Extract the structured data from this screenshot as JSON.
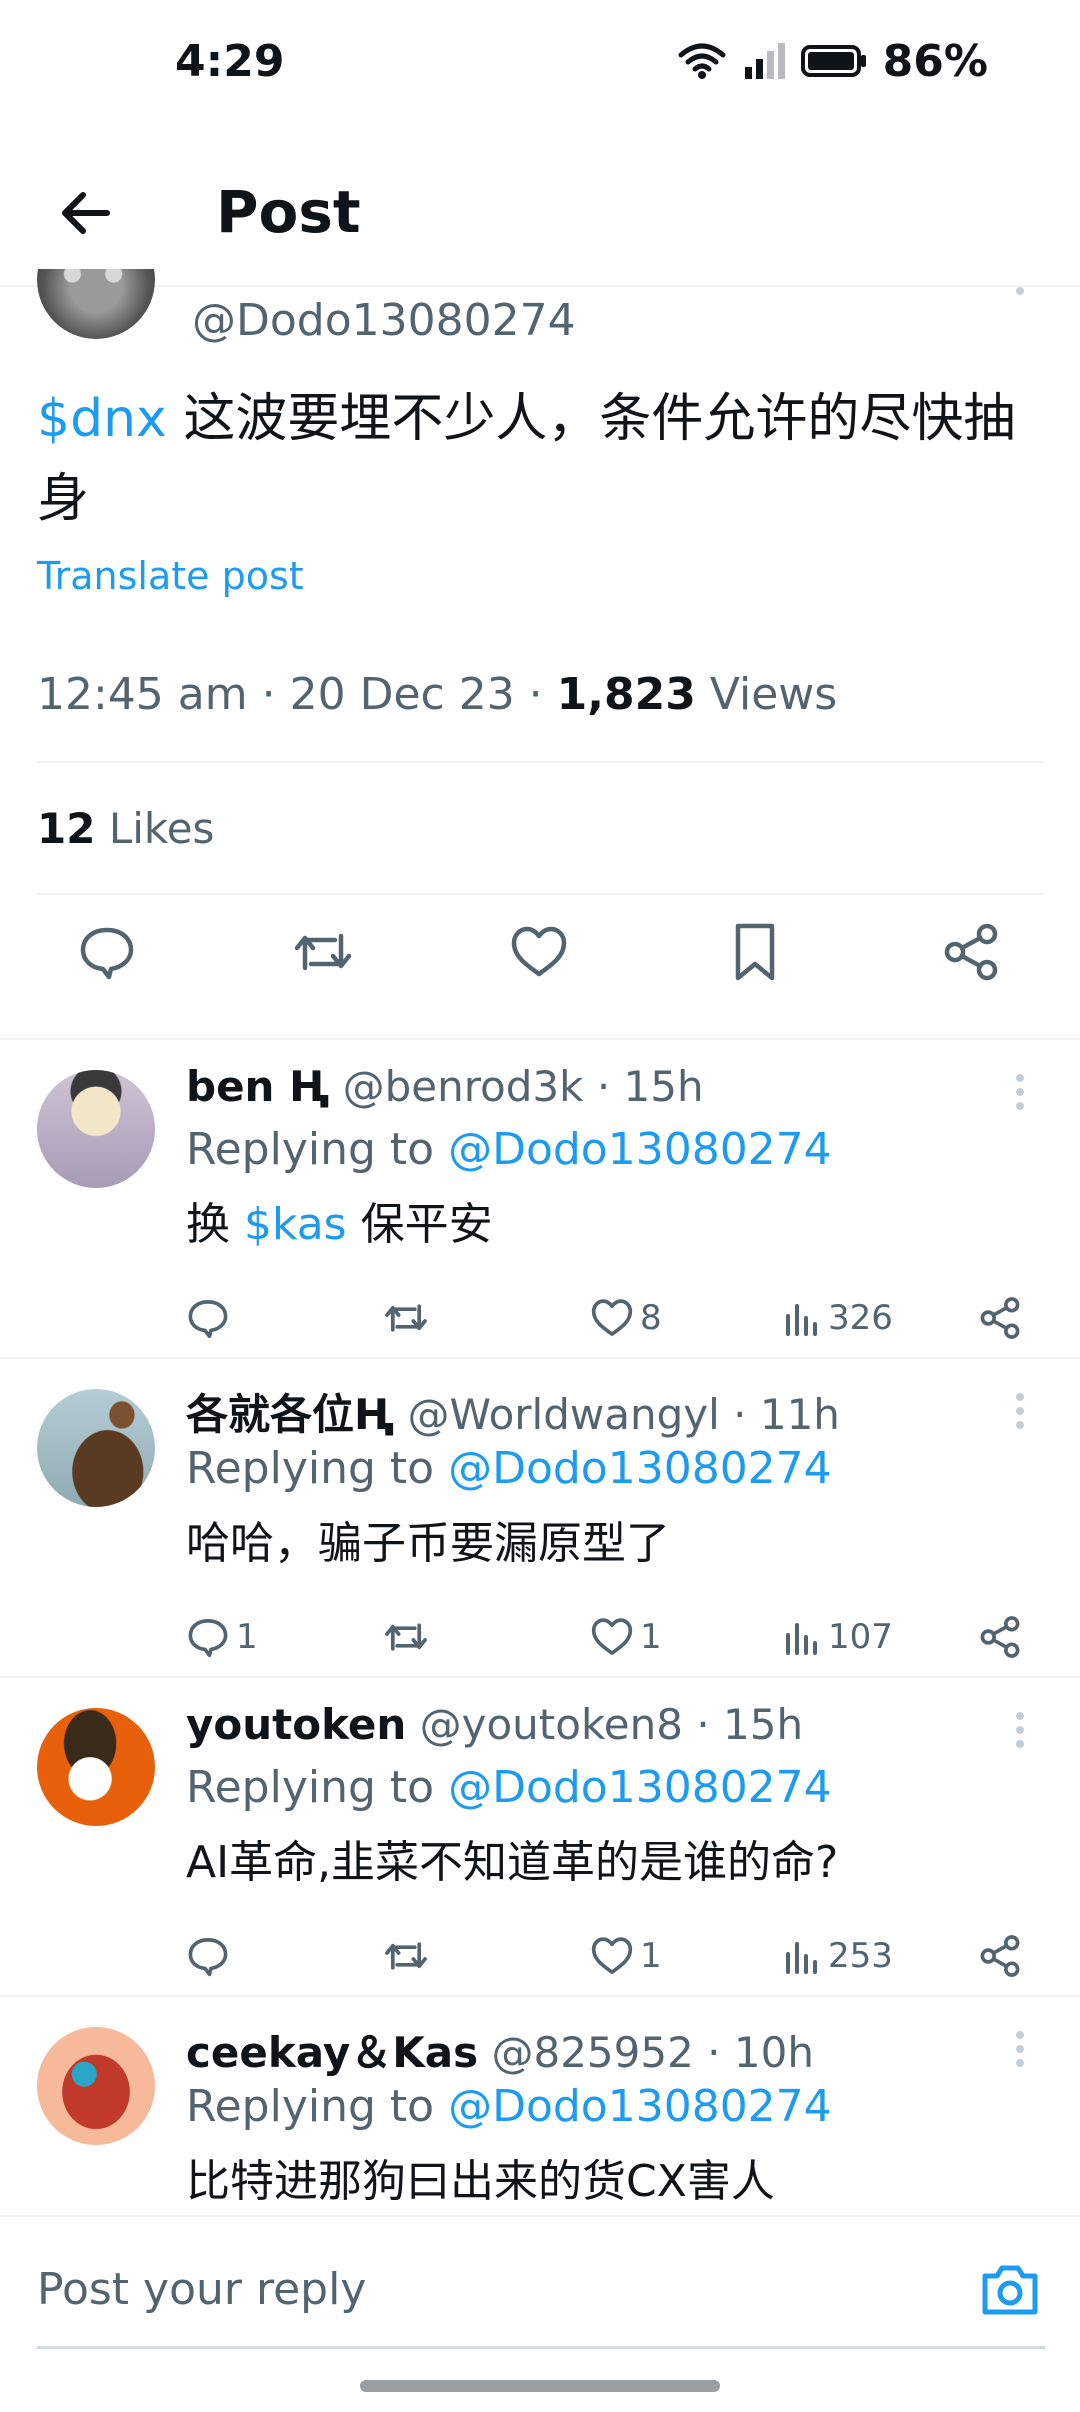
{
  "status_bar": {
    "time": "4:29",
    "battery": "86%"
  },
  "header": {
    "title": "Post"
  },
  "main_tweet": {
    "handle": "@Dodo13080274",
    "cashtag": "$dnx",
    "text": " 这波要埋不少人，条件允许的尽快抽身",
    "translate_label": "Translate post",
    "time": "12:45 am",
    "date": "20 Dec 23",
    "views_count": "1,823",
    "views_label": "Views",
    "likes_count": "12",
    "likes_label": "Likes"
  },
  "replies": [
    {
      "name": "ben Ⱨ",
      "handle": "@benrod3k",
      "age": "15h",
      "replying_prefix": "Replying to",
      "mention": "@Dodo13080274",
      "body_pre": "换 ",
      "body_tag": "$kas",
      "body_post": " 保平安",
      "reply_count": "",
      "like_count": "8",
      "view_count": "326"
    },
    {
      "name": "各就各位Ⱨ",
      "handle": "@Worldwangyl",
      "age": "11h",
      "replying_prefix": "Replying to",
      "mention": "@Dodo13080274",
      "body_pre": "哈哈，骗子币要漏原型了",
      "body_tag": "",
      "body_post": "",
      "reply_count": "1",
      "like_count": "1",
      "view_count": "107"
    },
    {
      "name": "youtoken",
      "handle": "@youtoken8",
      "age": "15h",
      "replying_prefix": "Replying to",
      "mention": "@Dodo13080274",
      "body_pre": "AI革命,韭菜不知道革的是谁的命?",
      "body_tag": "",
      "body_post": "",
      "reply_count": "",
      "like_count": "1",
      "view_count": "253"
    },
    {
      "name": "ceekay＆Kas",
      "handle": "@825952",
      "age": "10h",
      "replying_prefix": "Replying to",
      "mention": "@Dodo13080274",
      "body_pre": "比特进那狗曰出来的货CX害人",
      "body_tag": "",
      "body_post": "",
      "reply_count": "",
      "like_count": "",
      "view_count": ""
    }
  ],
  "composer": {
    "placeholder": "Post your reply"
  },
  "colors": {
    "accent": "#1d9bf0",
    "secondary_text": "#536471",
    "divider": "#eff3f4"
  }
}
